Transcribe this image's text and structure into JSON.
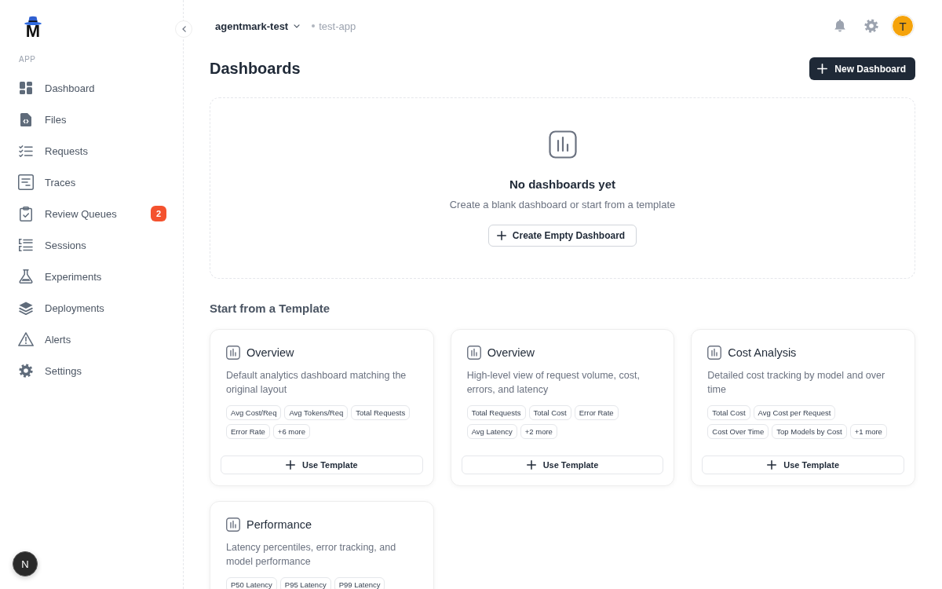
{
  "sidebar": {
    "logo": "M",
    "section_label": "APP",
    "items": [
      {
        "label": "Dashboard"
      },
      {
        "label": "Files"
      },
      {
        "label": "Requests"
      },
      {
        "label": "Traces"
      },
      {
        "label": "Review Queues",
        "badge": "2"
      },
      {
        "label": "Sessions"
      },
      {
        "label": "Experiments"
      },
      {
        "label": "Deployments"
      },
      {
        "label": "Alerts"
      },
      {
        "label": "Settings"
      }
    ],
    "dev_badge": "N"
  },
  "header": {
    "organization": "agentmark-test",
    "app": "test-app",
    "avatar": "T"
  },
  "page": {
    "title": "Dashboards",
    "new_button": "New Dashboard"
  },
  "empty_state": {
    "title": "No dashboards yet",
    "text": "Create a blank dashboard or start from a template",
    "button": "Create Empty Dashboard"
  },
  "templates": {
    "heading": "Start from a Template",
    "cards": [
      {
        "title": "Overview",
        "description": "Default analytics dashboard matching the original layout",
        "tags": [
          "Avg Cost/Req",
          "Avg Tokens/Req",
          "Total Requests",
          "Error Rate",
          "+6 more"
        ],
        "button": "Use Template"
      },
      {
        "title": "Overview",
        "description": "High-level view of request volume, cost, errors, and latency",
        "tags": [
          "Total Requests",
          "Total Cost",
          "Error Rate",
          "Avg Latency",
          "+2 more"
        ],
        "button": "Use Template"
      },
      {
        "title": "Cost Analysis",
        "description": "Detailed cost tracking by model and over time",
        "tags": [
          "Total Cost",
          "Avg Cost per Request",
          "Cost Over Time",
          "Top Models by Cost",
          "+1 more"
        ],
        "button": "Use Template"
      },
      {
        "title": "Performance",
        "description": "Latency percentiles, error tracking, and model performance",
        "tags": [
          "P50 Latency",
          "P95 Latency",
          "P99 Latency"
        ]
      }
    ]
  }
}
